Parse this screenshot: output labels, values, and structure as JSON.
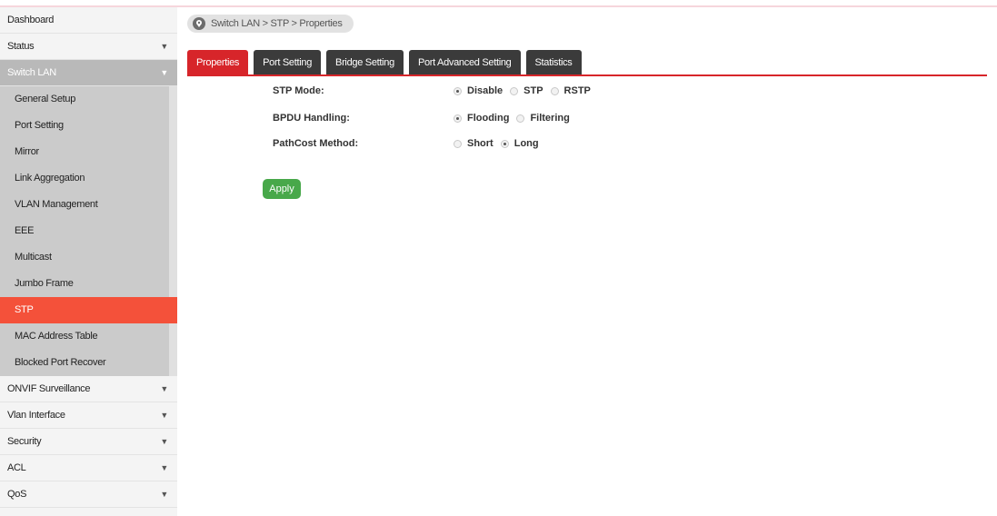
{
  "sidebar": {
    "items": [
      {
        "label": "Dashboard",
        "chevron": false
      },
      {
        "label": "Status",
        "chevron": true
      },
      {
        "label": "Switch LAN",
        "chevron": true,
        "expanded": true
      },
      {
        "label": "ONVIF Surveillance",
        "chevron": true
      },
      {
        "label": "Vlan Interface",
        "chevron": true
      },
      {
        "label": "Security",
        "chevron": true
      },
      {
        "label": "ACL",
        "chevron": true
      },
      {
        "label": "QoS",
        "chevron": true
      }
    ],
    "subitems": [
      {
        "label": "General Setup"
      },
      {
        "label": "Port Setting"
      },
      {
        "label": "Mirror"
      },
      {
        "label": "Link Aggregation"
      },
      {
        "label": "VLAN Management"
      },
      {
        "label": "EEE"
      },
      {
        "label": "Multicast"
      },
      {
        "label": "Jumbo Frame"
      },
      {
        "label": "STP",
        "active": true
      },
      {
        "label": "MAC Address Table"
      },
      {
        "label": "Blocked Port Recover"
      }
    ]
  },
  "breadcrumb": {
    "text": "Switch LAN > STP  > Properties"
  },
  "tabs": [
    "Properties",
    "Port Setting",
    "Bridge Setting",
    "Port Advanced Setting",
    "Statistics"
  ],
  "active_tab": "Properties",
  "form": {
    "stp_mode": {
      "label": "STP Mode:",
      "options": [
        "Disable",
        "STP",
        "RSTP"
      ],
      "selected": "Disable"
    },
    "bpdu": {
      "label": "BPDU Handling:",
      "options": [
        "Flooding",
        "Filtering"
      ],
      "selected": "Flooding"
    },
    "pathcost": {
      "label": "PathCost Method:",
      "options": [
        "Short",
        "Long"
      ],
      "selected": "Long"
    }
  },
  "apply_label": "Apply",
  "colors": {
    "accent": "#d7252a",
    "active_nav": "#f4513a",
    "apply": "#48a84a",
    "tab_dark": "#3b3b3b"
  }
}
